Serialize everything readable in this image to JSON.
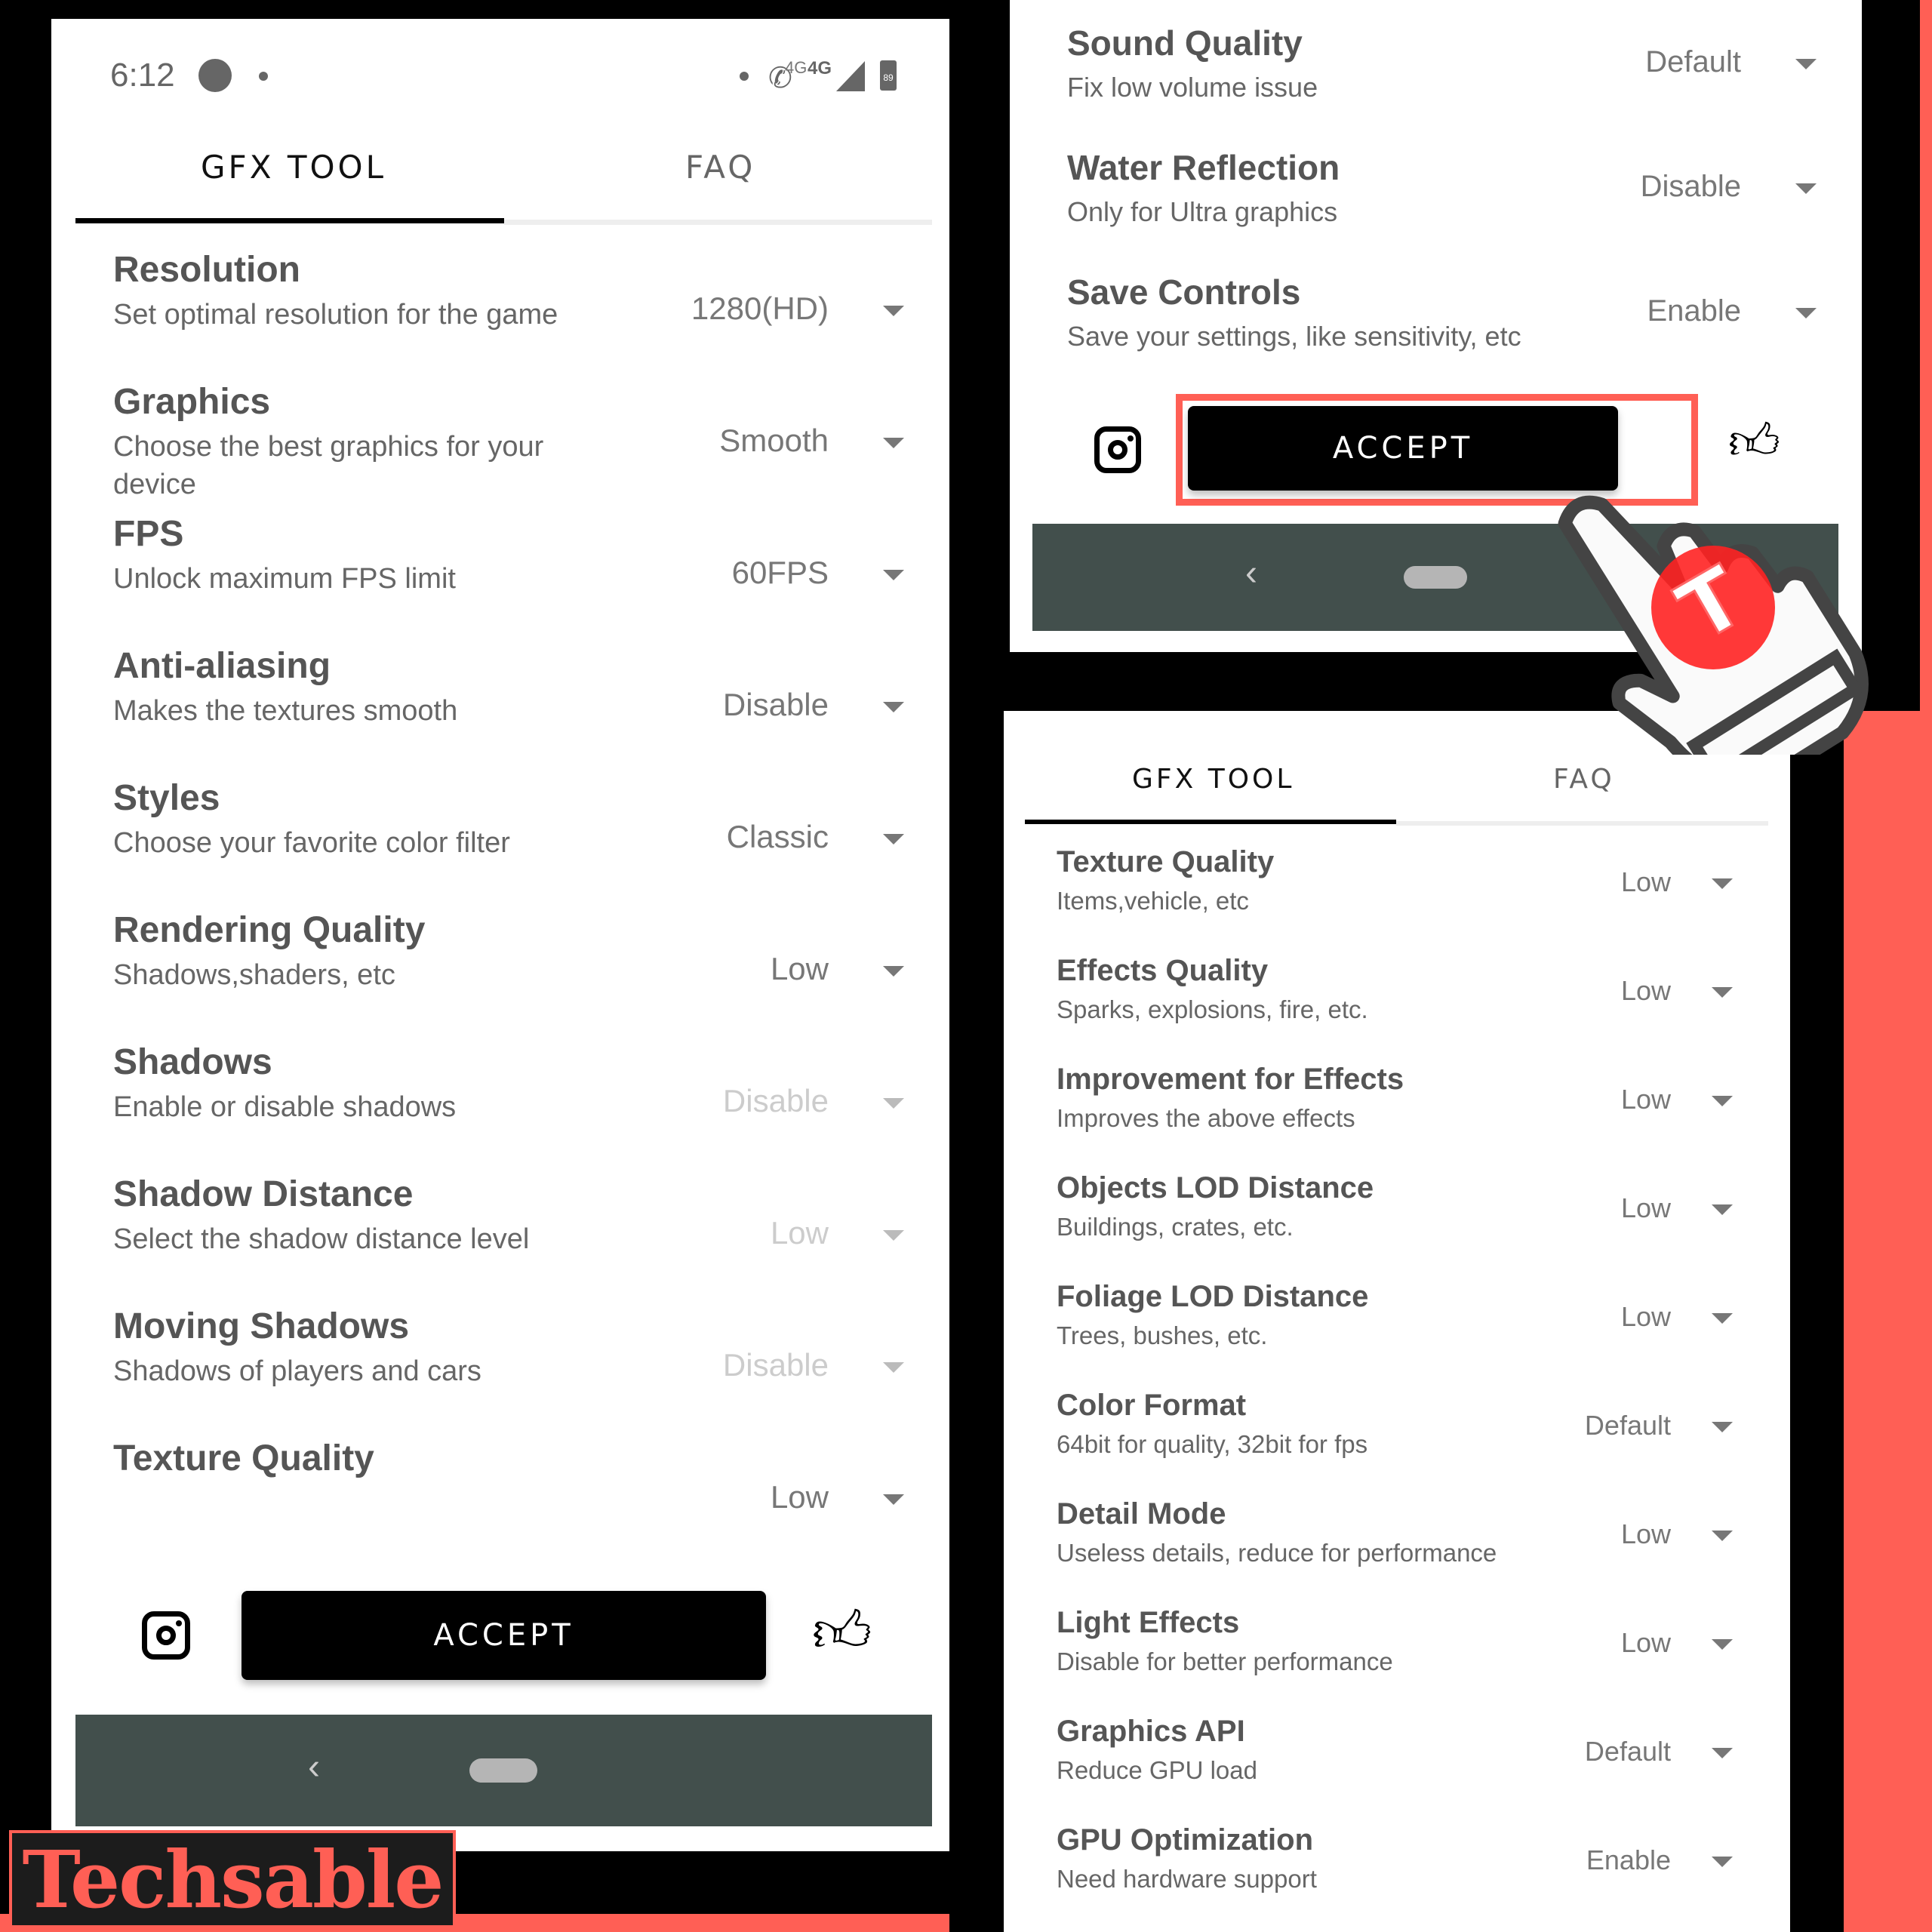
{
  "colors": {
    "accent_red": "#ff5f55",
    "nav_bar": "#424f4c",
    "accept_bg": "#000000",
    "text_title": "#555555",
    "text_sub": "#666666"
  },
  "status_bar": {
    "time": "6:12",
    "network_1": "4G",
    "network_2": "4G",
    "battery": "89",
    "icons": [
      "spotify-icon",
      "notification-dot",
      "call-icon",
      "signal-icon",
      "battery-icon"
    ]
  },
  "tabs": [
    {
      "label": "GFX TOOL",
      "active": true
    },
    {
      "label": "FAQ",
      "active": false
    }
  ],
  "left_panel": {
    "settings": [
      {
        "title": "Resolution",
        "subtitle": "Set optimal resolution for the game",
        "value": "1280(HD)",
        "enabled": true
      },
      {
        "title": "Graphics",
        "subtitle": "Choose the best graphics for your device",
        "value": "Smooth",
        "enabled": true
      },
      {
        "title": "FPS",
        "subtitle": "Unlock maximum FPS limit",
        "value": "60FPS",
        "enabled": true
      },
      {
        "title": "Anti-aliasing",
        "subtitle": "Makes the textures smooth",
        "value": "Disable",
        "enabled": true
      },
      {
        "title": "Styles",
        "subtitle": "Choose your favorite color filter",
        "value": "Classic",
        "enabled": true
      },
      {
        "title": "Rendering Quality",
        "subtitle": "Shadows,shaders, etc",
        "value": "Low",
        "enabled": true
      },
      {
        "title": "Shadows",
        "subtitle": "Enable or disable shadows",
        "value": "Disable",
        "enabled": false
      },
      {
        "title": "Shadow Distance",
        "subtitle": "Select the shadow distance level",
        "value": "Low",
        "enabled": false
      },
      {
        "title": "Moving Shadows",
        "subtitle": "Shadows of players and cars",
        "value": "Disable",
        "enabled": false
      },
      {
        "title": "Texture Quality",
        "subtitle": "",
        "value": "Low",
        "enabled": true
      }
    ],
    "accept_label": "ACCEPT"
  },
  "top_right_panel": {
    "settings": [
      {
        "title": "Sound Quality",
        "subtitle": "Fix low volume issue",
        "value": "Default"
      },
      {
        "title": "Water Reflection",
        "subtitle": "Only for Ultra graphics",
        "value": "Disable"
      },
      {
        "title": "Save Controls",
        "subtitle": "Save your settings, like sensitivity, etc",
        "value": "Enable"
      }
    ],
    "accept_label": "ACCEPT",
    "accept_highlighted": true
  },
  "bottom_right_panel": {
    "settings": [
      {
        "title": "Texture Quality",
        "subtitle": "Items,vehicle, etc",
        "value": "Low"
      },
      {
        "title": "Effects Quality",
        "subtitle": "Sparks, explosions, fire, etc.",
        "value": "Low"
      },
      {
        "title": "Improvement for Effects",
        "subtitle": "Improves the above effects",
        "value": "Low"
      },
      {
        "title": "Objects LOD Distance",
        "subtitle": "Buildings, crates, etc.",
        "value": "Low"
      },
      {
        "title": "Foliage LOD Distance",
        "subtitle": "Trees, bushes, etc.",
        "value": "Low"
      },
      {
        "title": "Color Format",
        "subtitle": "64bit for quality, 32bit for fps",
        "value": "Default"
      },
      {
        "title": "Detail Mode",
        "subtitle": "Useless details, reduce for performance",
        "value": "Low"
      },
      {
        "title": "Light Effects",
        "subtitle": "Disable for better performance",
        "value": "Low"
      },
      {
        "title": "Graphics API",
        "subtitle": "Reduce GPU load",
        "value": "Default"
      },
      {
        "title": "GPU Optimization",
        "subtitle": "Need hardware support",
        "value": "Enable"
      }
    ]
  },
  "overlay": {
    "pointer": "hand-pointer-icon",
    "pointer_badge_letter": "T"
  },
  "watermark": {
    "text": "Techsable"
  }
}
